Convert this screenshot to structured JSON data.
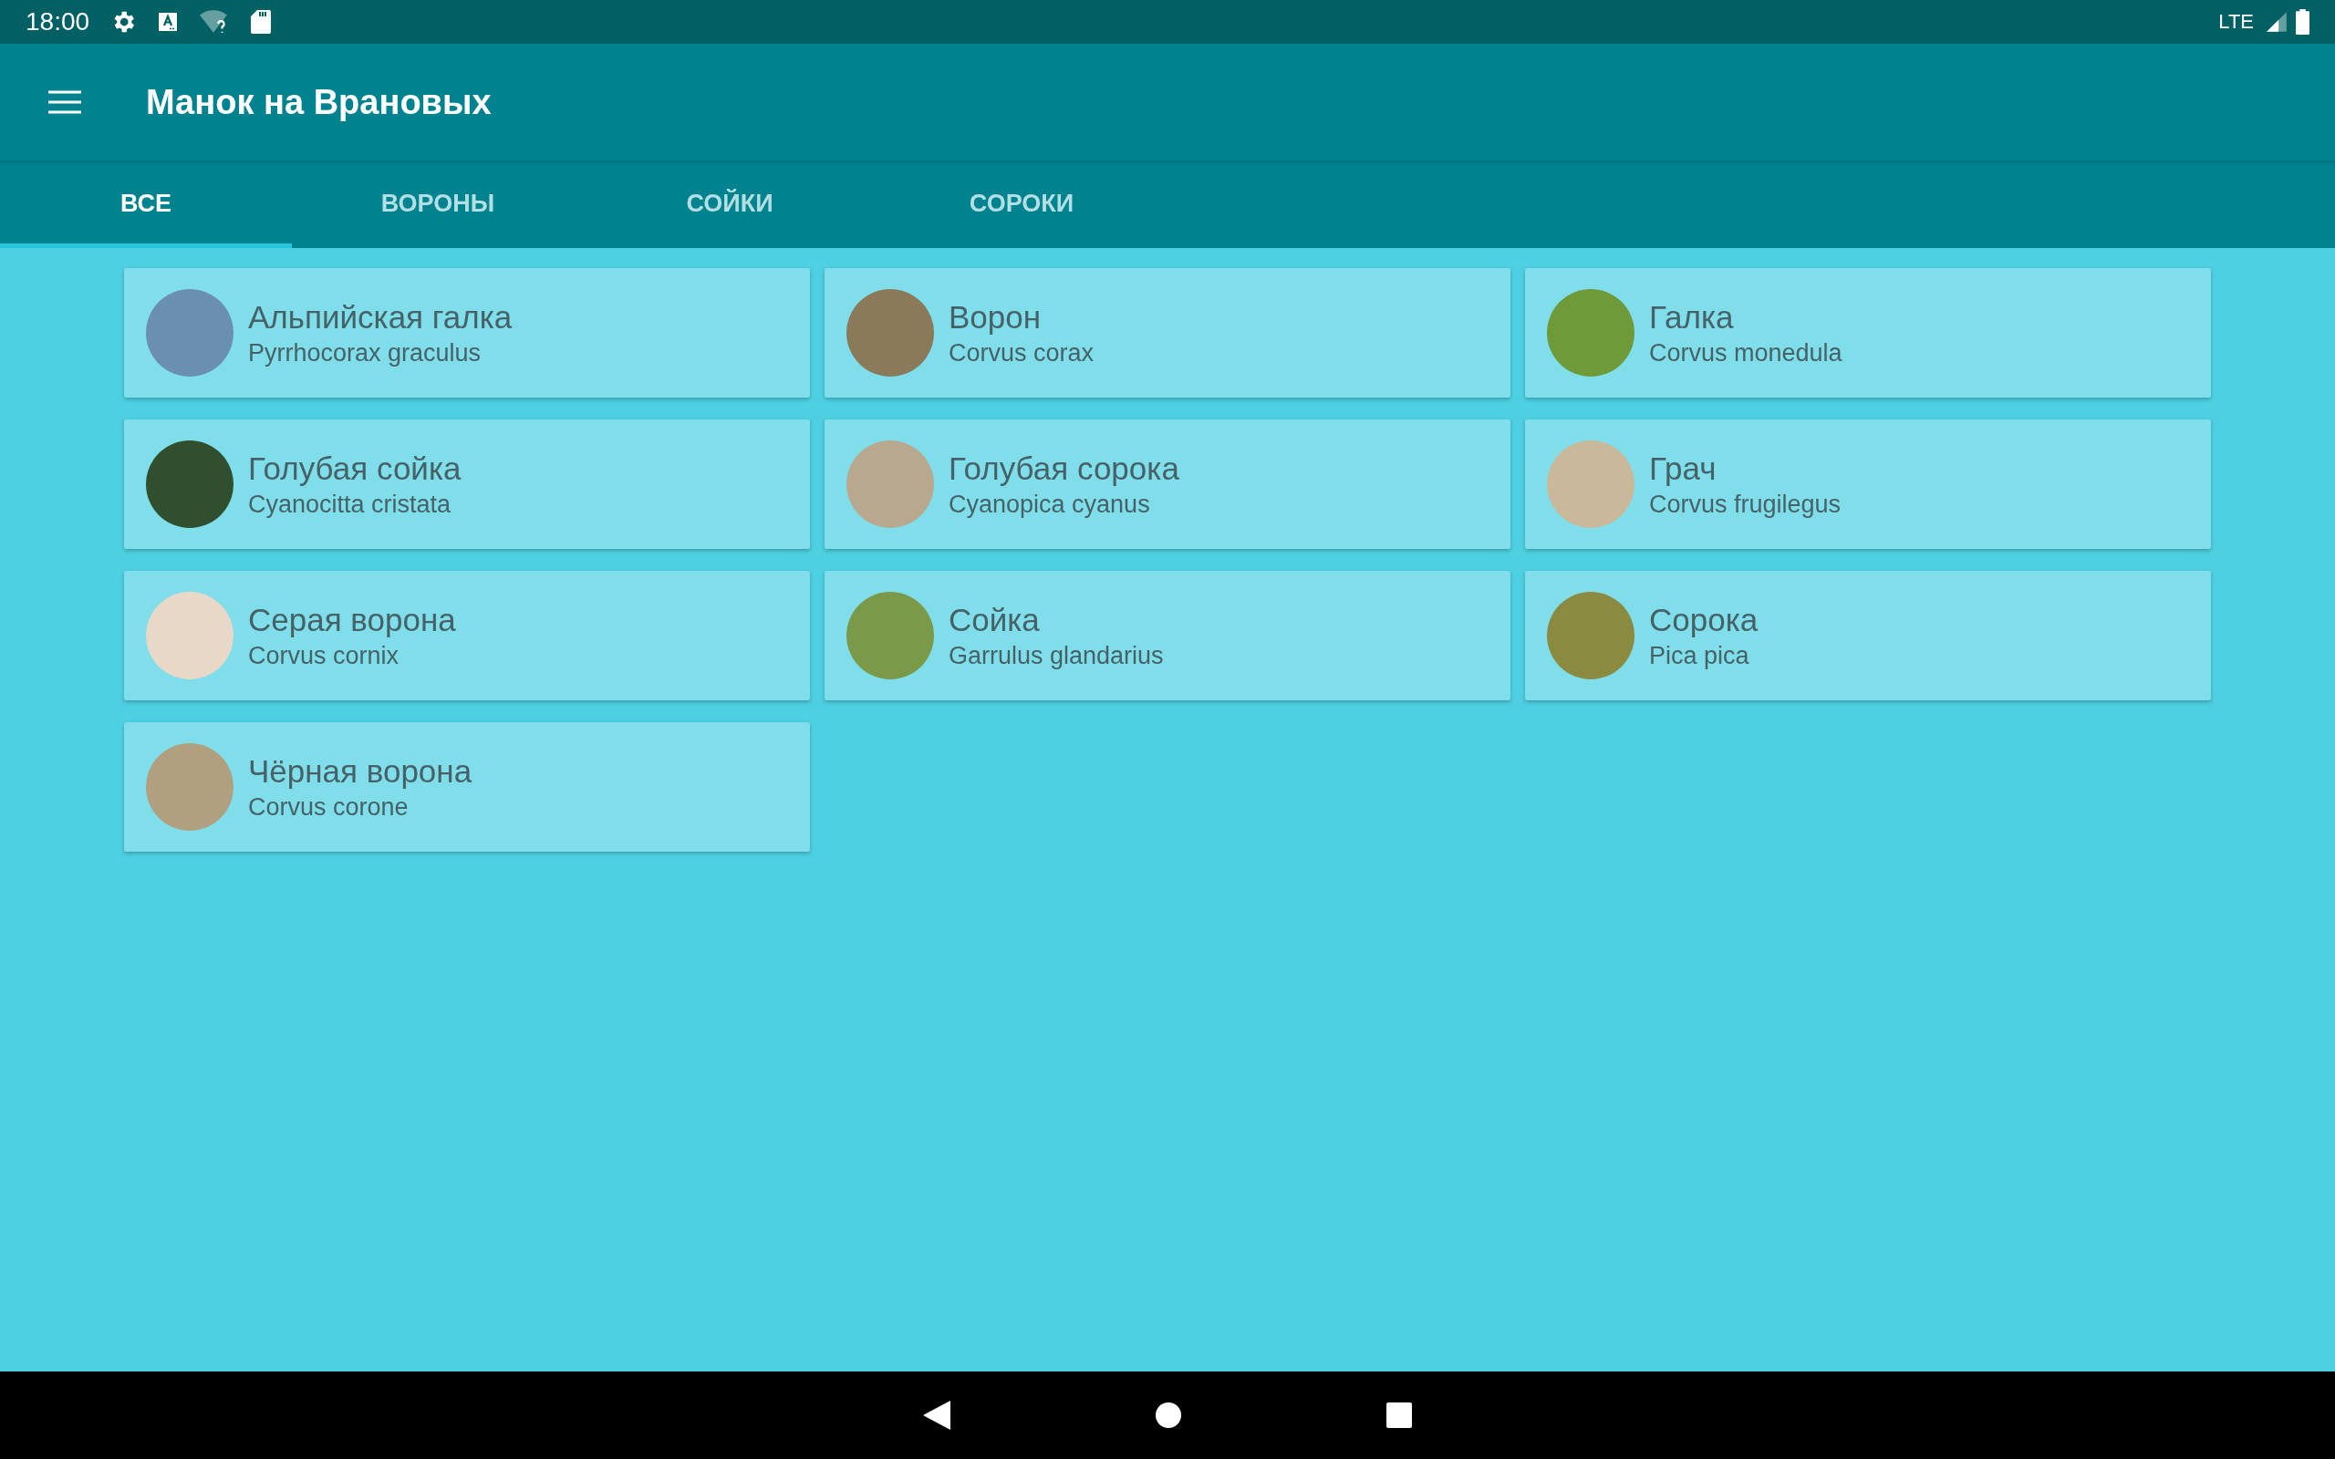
{
  "status_bar": {
    "time": "18:00",
    "network": "LTE"
  },
  "app_bar": {
    "title": "Манок на Врановых"
  },
  "tabs": [
    {
      "label": "ВСЕ",
      "selected": true
    },
    {
      "label": "ВОРОНЫ",
      "selected": false
    },
    {
      "label": "СОЙКИ",
      "selected": false
    },
    {
      "label": "СОРОКИ",
      "selected": false
    }
  ],
  "birds": [
    {
      "name": "Альпийская галка",
      "latin": "Pyrrhocorax graculus"
    },
    {
      "name": "Ворон",
      "latin": "Corvus corax"
    },
    {
      "name": "Галка",
      "latin": "Corvus monedula"
    },
    {
      "name": "Голубая сойка",
      "latin": "Cyanocitta cristata"
    },
    {
      "name": "Голубая сорока",
      "latin": "Cyanopica cyanus"
    },
    {
      "name": "Грач",
      "latin": "Corvus frugilegus"
    },
    {
      "name": "Серая ворона",
      "latin": "Corvus cornix"
    },
    {
      "name": "Сойка",
      "latin": "Garrulus glandarius"
    },
    {
      "name": "Сорока",
      "latin": "Pica pica"
    },
    {
      "name": "Чёрная ворона",
      "latin": "Corvus corone"
    }
  ]
}
